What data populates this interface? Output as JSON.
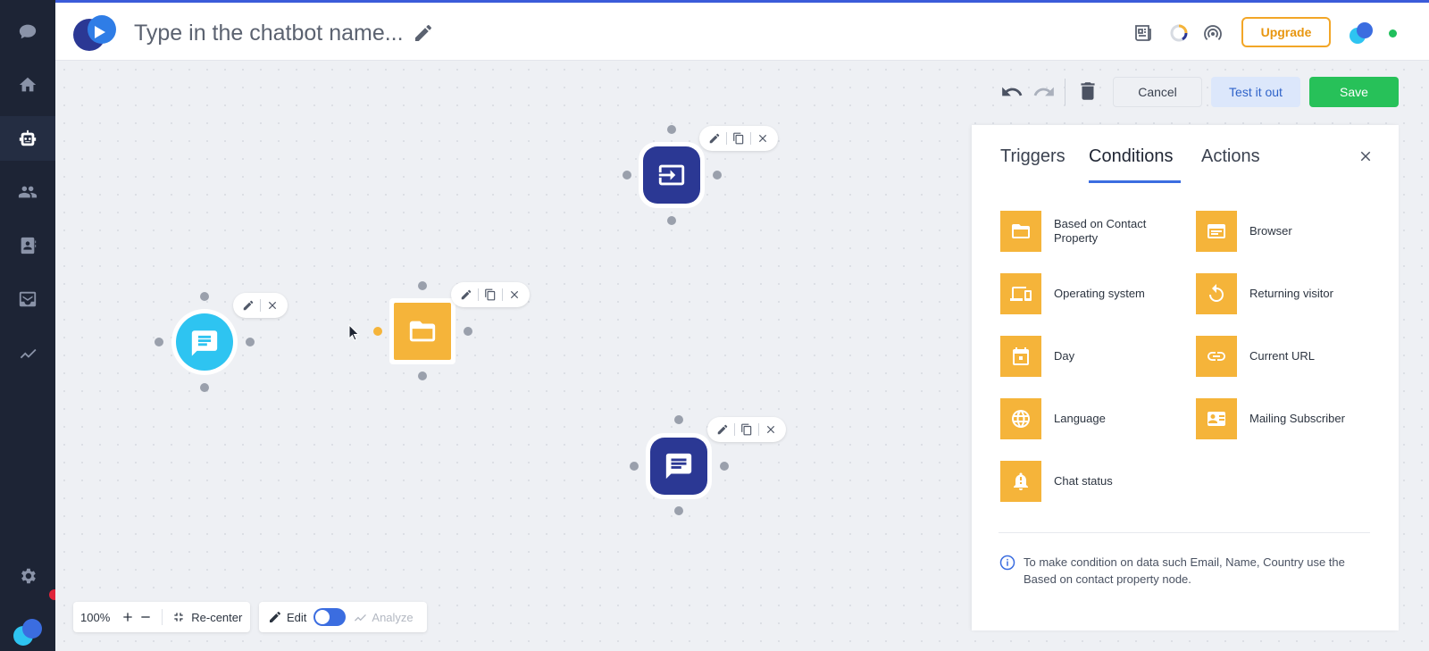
{
  "header": {
    "chatbot_name_placeholder": "Type in the chatbot name...",
    "upgrade_label": "Upgrade"
  },
  "sidebar": {
    "items": [
      "chat",
      "home",
      "chatbots",
      "contacts",
      "contacts-book",
      "inbox",
      "analytics"
    ],
    "active": "chatbots"
  },
  "toolbar": {
    "cancel_label": "Cancel",
    "test_label": "Test it out",
    "save_label": "Save"
  },
  "panel": {
    "tabs": [
      {
        "label": "Triggers"
      },
      {
        "label": "Conditions"
      },
      {
        "label": "Actions"
      }
    ],
    "active_tab": "Conditions",
    "conditions": [
      {
        "label": "Based on Contact Property",
        "icon": "folder-icon"
      },
      {
        "label": "Browser",
        "icon": "browser-icon"
      },
      {
        "label": "Operating system",
        "icon": "devices-icon"
      },
      {
        "label": "Returning visitor",
        "icon": "refresh-icon"
      },
      {
        "label": "Day",
        "icon": "calendar-icon"
      },
      {
        "label": "Current URL",
        "icon": "link-icon"
      },
      {
        "label": "Language",
        "icon": "globe-icon"
      },
      {
        "label": "Mailing Subscriber",
        "icon": "contact-card-icon"
      },
      {
        "label": "Chat status",
        "icon": "alert-bell-icon"
      }
    ],
    "info_text": "To make condition on data such Email, Name, Country use the Based on contact property node."
  },
  "bottom": {
    "zoom": "100%",
    "recenter_label": "Re-center",
    "edit_label": "Edit",
    "analyze_label": "Analyze"
  },
  "colors": {
    "accent": "#3b6de0",
    "condition": "#f5b43a",
    "save": "#27c159",
    "node_dark": "#2b3894",
    "node_light": "#2ec4f1",
    "sidebar": "#1d2435"
  }
}
